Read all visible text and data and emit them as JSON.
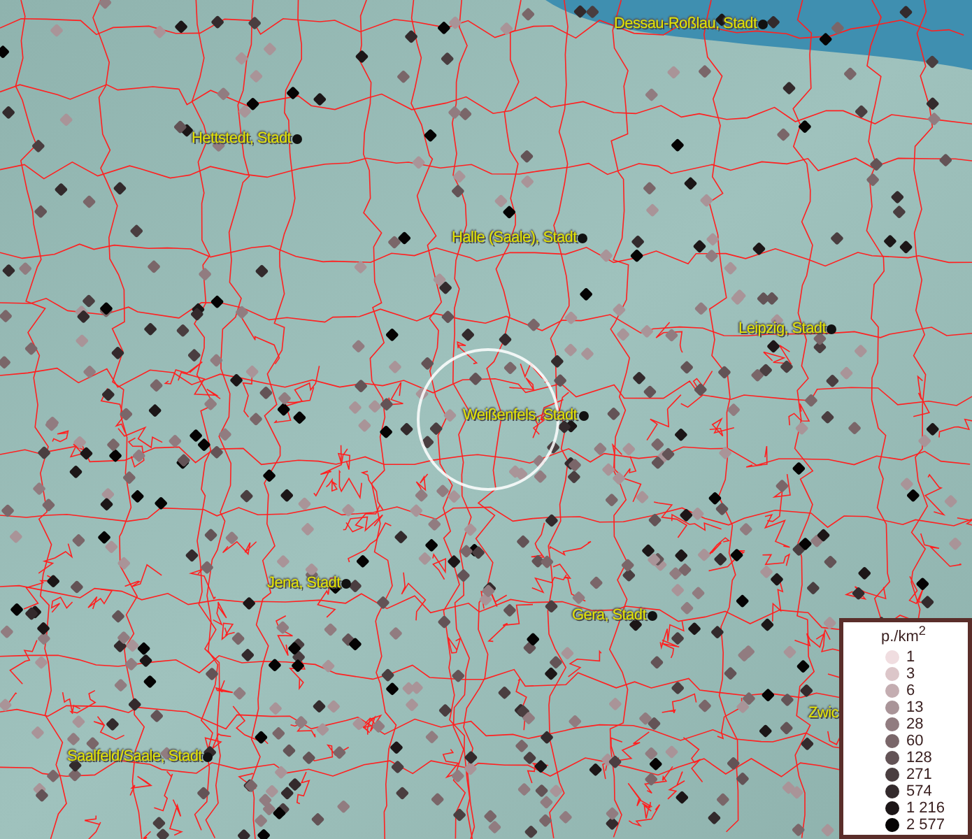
{
  "map": {
    "labels": [
      {
        "text": "Dessau-Roßlau, Stadt"
      },
      {
        "text": "Hettstedt, Stadt"
      },
      {
        "text": "Halle (Saale), Stadt"
      },
      {
        "text": "Leipzig, Stadt"
      },
      {
        "text": "Weißenfels, Stadt"
      },
      {
        "text": "Jena, Stadt"
      },
      {
        "text": "Gera, Stadt"
      },
      {
        "text": "Saalfeld/Saale, Stadt"
      },
      {
        "text": "Zwic"
      }
    ]
  },
  "legend": {
    "title": "p./km$^{2}$",
    "entries": [
      {
        "label": "1",
        "color": "#f0dde0"
      },
      {
        "label": "3",
        "color": "#dcc6c9"
      },
      {
        "label": "6",
        "color": "#c4adb1"
      },
      {
        "label": "13",
        "color": "#a99498"
      },
      {
        "label": "28",
        "color": "#917c80"
      },
      {
        "label": "60",
        "color": "#7a6669"
      },
      {
        "label": "128",
        "color": "#635356"
      },
      {
        "label": "271",
        "color": "#4a3e40"
      },
      {
        "label": "574",
        "color": "#332a2c"
      },
      {
        "label": "1 216",
        "color": "#1c1617"
      },
      {
        "label": "2 577",
        "color": "#050303"
      }
    ]
  }
}
